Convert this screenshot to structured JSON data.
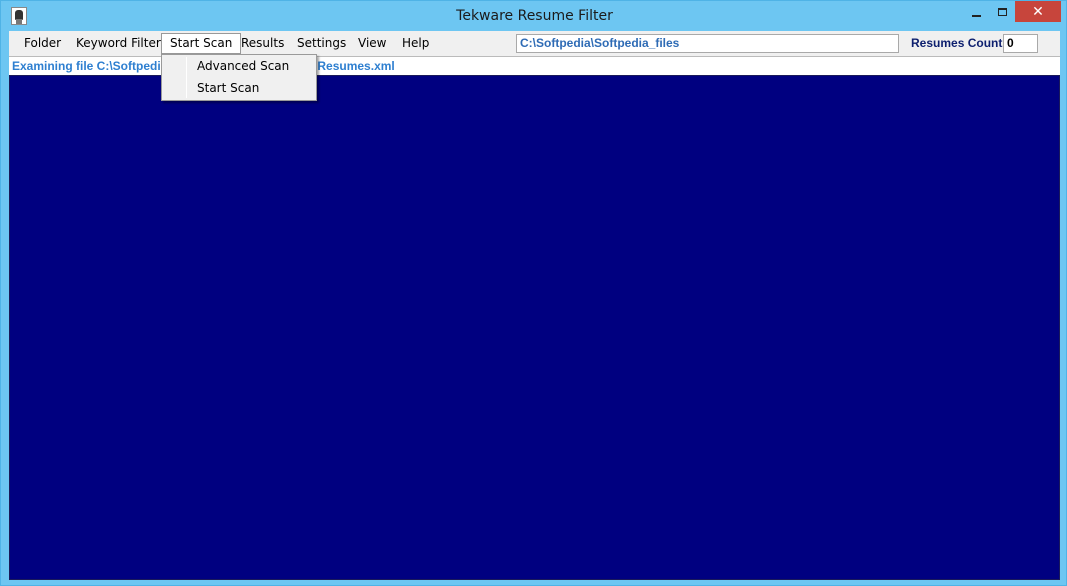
{
  "window": {
    "title": "Tekware Resume Filter",
    "close_glyph": "✕"
  },
  "menubar": {
    "items": [
      {
        "label": "Folder"
      },
      {
        "label": "Keyword Filter"
      },
      {
        "label": "Start Scan"
      },
      {
        "label": "Results"
      },
      {
        "label": "Settings"
      },
      {
        "label": "View"
      },
      {
        "label": "Help"
      }
    ],
    "active": "Start Scan"
  },
  "toolbar": {
    "path_value": "C:\\Softpedia\\Softpedia_files",
    "resumes_count_label": "Resumes Count",
    "resumes_count_value": "0"
  },
  "status": {
    "text": "Examining file C:\\Softpedia\\Softpedia_files\\Softpedia Resumes.xml"
  },
  "dropdown": {
    "items": [
      {
        "label": "Advanced Scan"
      },
      {
        "label": "Start Scan"
      }
    ]
  },
  "colors": {
    "titlebar": "#6dc6f2",
    "results_background": "#000080",
    "close_button": "#c7453c",
    "path_text": "#2e6bb5"
  }
}
